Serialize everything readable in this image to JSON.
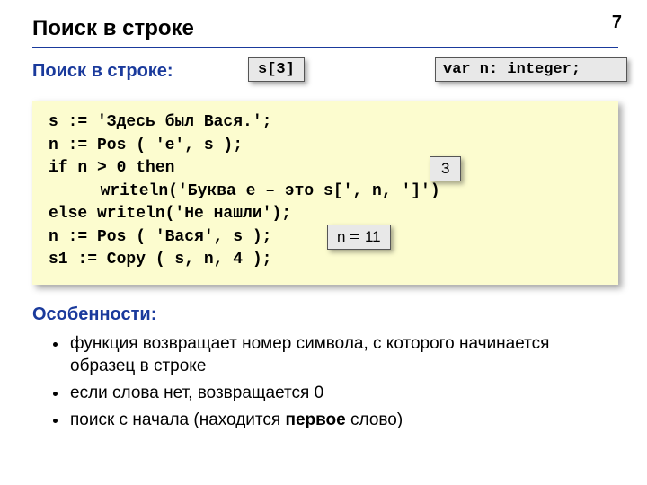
{
  "page_number": "7",
  "title": "Поиск в строке",
  "subtitle": "Поиск в строке:",
  "badges": {
    "s3": "s[3]",
    "var_decl": "var n: integer;",
    "b3": "3",
    "bn_left": "n",
    "bn_right": "11"
  },
  "code": {
    "l1": "s := 'Здесь был Вася.';",
    "l2": "n := Pos ( 'е', s );",
    "l3": "if n > 0 then",
    "l4": "writeln('Буква е – это s[', n, ']')",
    "l5": "else writeln('Не нашли');",
    "l6": "n := Pos ( 'Вася', s );",
    "l7": "s1 := Copy ( s, n, 4 );"
  },
  "features": {
    "title": "Особенности:",
    "items": [
      {
        "text_a": "функция возвращает номер символа, с которого начинается образец в строке",
        "bold": "",
        "text_b": ""
      },
      {
        "text_a": "если слова нет, возвращается 0",
        "bold": "",
        "text_b": ""
      },
      {
        "text_a": "поиск с начала (находится ",
        "bold": "первое",
        "text_b": " слово)"
      }
    ]
  }
}
